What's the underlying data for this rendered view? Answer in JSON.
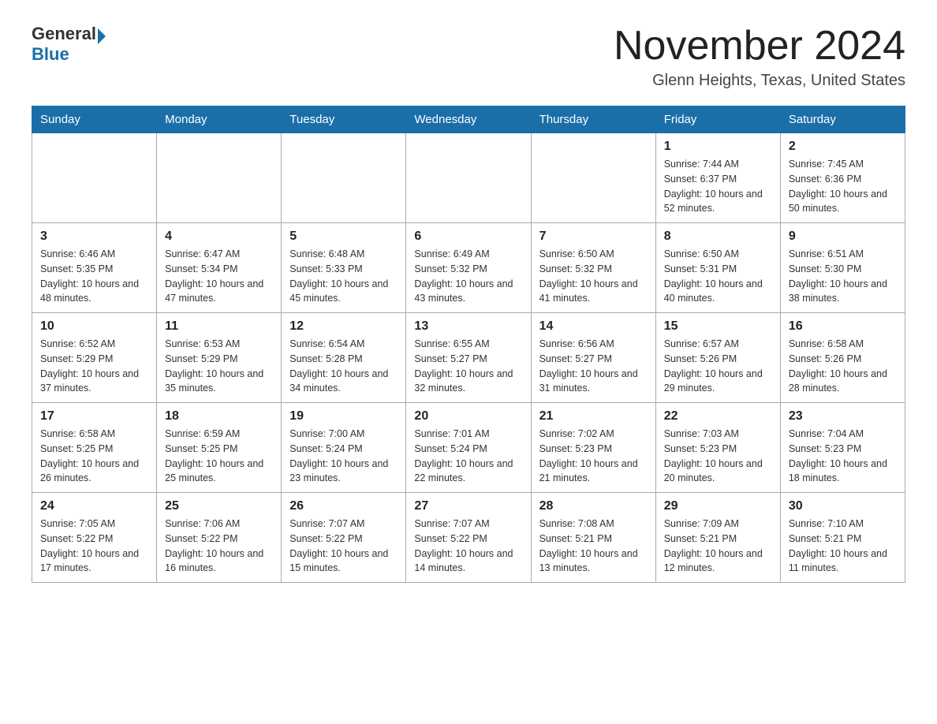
{
  "header": {
    "logo_general": "General",
    "logo_blue": "Blue",
    "month_title": "November 2024",
    "location": "Glenn Heights, Texas, United States"
  },
  "weekdays": [
    "Sunday",
    "Monday",
    "Tuesday",
    "Wednesday",
    "Thursday",
    "Friday",
    "Saturday"
  ],
  "weeks": [
    [
      {
        "day": "",
        "sunrise": "",
        "sunset": "",
        "daylight": ""
      },
      {
        "day": "",
        "sunrise": "",
        "sunset": "",
        "daylight": ""
      },
      {
        "day": "",
        "sunrise": "",
        "sunset": "",
        "daylight": ""
      },
      {
        "day": "",
        "sunrise": "",
        "sunset": "",
        "daylight": ""
      },
      {
        "day": "",
        "sunrise": "",
        "sunset": "",
        "daylight": ""
      },
      {
        "day": "1",
        "sunrise": "Sunrise: 7:44 AM",
        "sunset": "Sunset: 6:37 PM",
        "daylight": "Daylight: 10 hours and 52 minutes."
      },
      {
        "day": "2",
        "sunrise": "Sunrise: 7:45 AM",
        "sunset": "Sunset: 6:36 PM",
        "daylight": "Daylight: 10 hours and 50 minutes."
      }
    ],
    [
      {
        "day": "3",
        "sunrise": "Sunrise: 6:46 AM",
        "sunset": "Sunset: 5:35 PM",
        "daylight": "Daylight: 10 hours and 48 minutes."
      },
      {
        "day": "4",
        "sunrise": "Sunrise: 6:47 AM",
        "sunset": "Sunset: 5:34 PM",
        "daylight": "Daylight: 10 hours and 47 minutes."
      },
      {
        "day": "5",
        "sunrise": "Sunrise: 6:48 AM",
        "sunset": "Sunset: 5:33 PM",
        "daylight": "Daylight: 10 hours and 45 minutes."
      },
      {
        "day": "6",
        "sunrise": "Sunrise: 6:49 AM",
        "sunset": "Sunset: 5:32 PM",
        "daylight": "Daylight: 10 hours and 43 minutes."
      },
      {
        "day": "7",
        "sunrise": "Sunrise: 6:50 AM",
        "sunset": "Sunset: 5:32 PM",
        "daylight": "Daylight: 10 hours and 41 minutes."
      },
      {
        "day": "8",
        "sunrise": "Sunrise: 6:50 AM",
        "sunset": "Sunset: 5:31 PM",
        "daylight": "Daylight: 10 hours and 40 minutes."
      },
      {
        "day": "9",
        "sunrise": "Sunrise: 6:51 AM",
        "sunset": "Sunset: 5:30 PM",
        "daylight": "Daylight: 10 hours and 38 minutes."
      }
    ],
    [
      {
        "day": "10",
        "sunrise": "Sunrise: 6:52 AM",
        "sunset": "Sunset: 5:29 PM",
        "daylight": "Daylight: 10 hours and 37 minutes."
      },
      {
        "day": "11",
        "sunrise": "Sunrise: 6:53 AM",
        "sunset": "Sunset: 5:29 PM",
        "daylight": "Daylight: 10 hours and 35 minutes."
      },
      {
        "day": "12",
        "sunrise": "Sunrise: 6:54 AM",
        "sunset": "Sunset: 5:28 PM",
        "daylight": "Daylight: 10 hours and 34 minutes."
      },
      {
        "day": "13",
        "sunrise": "Sunrise: 6:55 AM",
        "sunset": "Sunset: 5:27 PM",
        "daylight": "Daylight: 10 hours and 32 minutes."
      },
      {
        "day": "14",
        "sunrise": "Sunrise: 6:56 AM",
        "sunset": "Sunset: 5:27 PM",
        "daylight": "Daylight: 10 hours and 31 minutes."
      },
      {
        "day": "15",
        "sunrise": "Sunrise: 6:57 AM",
        "sunset": "Sunset: 5:26 PM",
        "daylight": "Daylight: 10 hours and 29 minutes."
      },
      {
        "day": "16",
        "sunrise": "Sunrise: 6:58 AM",
        "sunset": "Sunset: 5:26 PM",
        "daylight": "Daylight: 10 hours and 28 minutes."
      }
    ],
    [
      {
        "day": "17",
        "sunrise": "Sunrise: 6:58 AM",
        "sunset": "Sunset: 5:25 PM",
        "daylight": "Daylight: 10 hours and 26 minutes."
      },
      {
        "day": "18",
        "sunrise": "Sunrise: 6:59 AM",
        "sunset": "Sunset: 5:25 PM",
        "daylight": "Daylight: 10 hours and 25 minutes."
      },
      {
        "day": "19",
        "sunrise": "Sunrise: 7:00 AM",
        "sunset": "Sunset: 5:24 PM",
        "daylight": "Daylight: 10 hours and 23 minutes."
      },
      {
        "day": "20",
        "sunrise": "Sunrise: 7:01 AM",
        "sunset": "Sunset: 5:24 PM",
        "daylight": "Daylight: 10 hours and 22 minutes."
      },
      {
        "day": "21",
        "sunrise": "Sunrise: 7:02 AM",
        "sunset": "Sunset: 5:23 PM",
        "daylight": "Daylight: 10 hours and 21 minutes."
      },
      {
        "day": "22",
        "sunrise": "Sunrise: 7:03 AM",
        "sunset": "Sunset: 5:23 PM",
        "daylight": "Daylight: 10 hours and 20 minutes."
      },
      {
        "day": "23",
        "sunrise": "Sunrise: 7:04 AM",
        "sunset": "Sunset: 5:23 PM",
        "daylight": "Daylight: 10 hours and 18 minutes."
      }
    ],
    [
      {
        "day": "24",
        "sunrise": "Sunrise: 7:05 AM",
        "sunset": "Sunset: 5:22 PM",
        "daylight": "Daylight: 10 hours and 17 minutes."
      },
      {
        "day": "25",
        "sunrise": "Sunrise: 7:06 AM",
        "sunset": "Sunset: 5:22 PM",
        "daylight": "Daylight: 10 hours and 16 minutes."
      },
      {
        "day": "26",
        "sunrise": "Sunrise: 7:07 AM",
        "sunset": "Sunset: 5:22 PM",
        "daylight": "Daylight: 10 hours and 15 minutes."
      },
      {
        "day": "27",
        "sunrise": "Sunrise: 7:07 AM",
        "sunset": "Sunset: 5:22 PM",
        "daylight": "Daylight: 10 hours and 14 minutes."
      },
      {
        "day": "28",
        "sunrise": "Sunrise: 7:08 AM",
        "sunset": "Sunset: 5:21 PM",
        "daylight": "Daylight: 10 hours and 13 minutes."
      },
      {
        "day": "29",
        "sunrise": "Sunrise: 7:09 AM",
        "sunset": "Sunset: 5:21 PM",
        "daylight": "Daylight: 10 hours and 12 minutes."
      },
      {
        "day": "30",
        "sunrise": "Sunrise: 7:10 AM",
        "sunset": "Sunset: 5:21 PM",
        "daylight": "Daylight: 10 hours and 11 minutes."
      }
    ]
  ]
}
